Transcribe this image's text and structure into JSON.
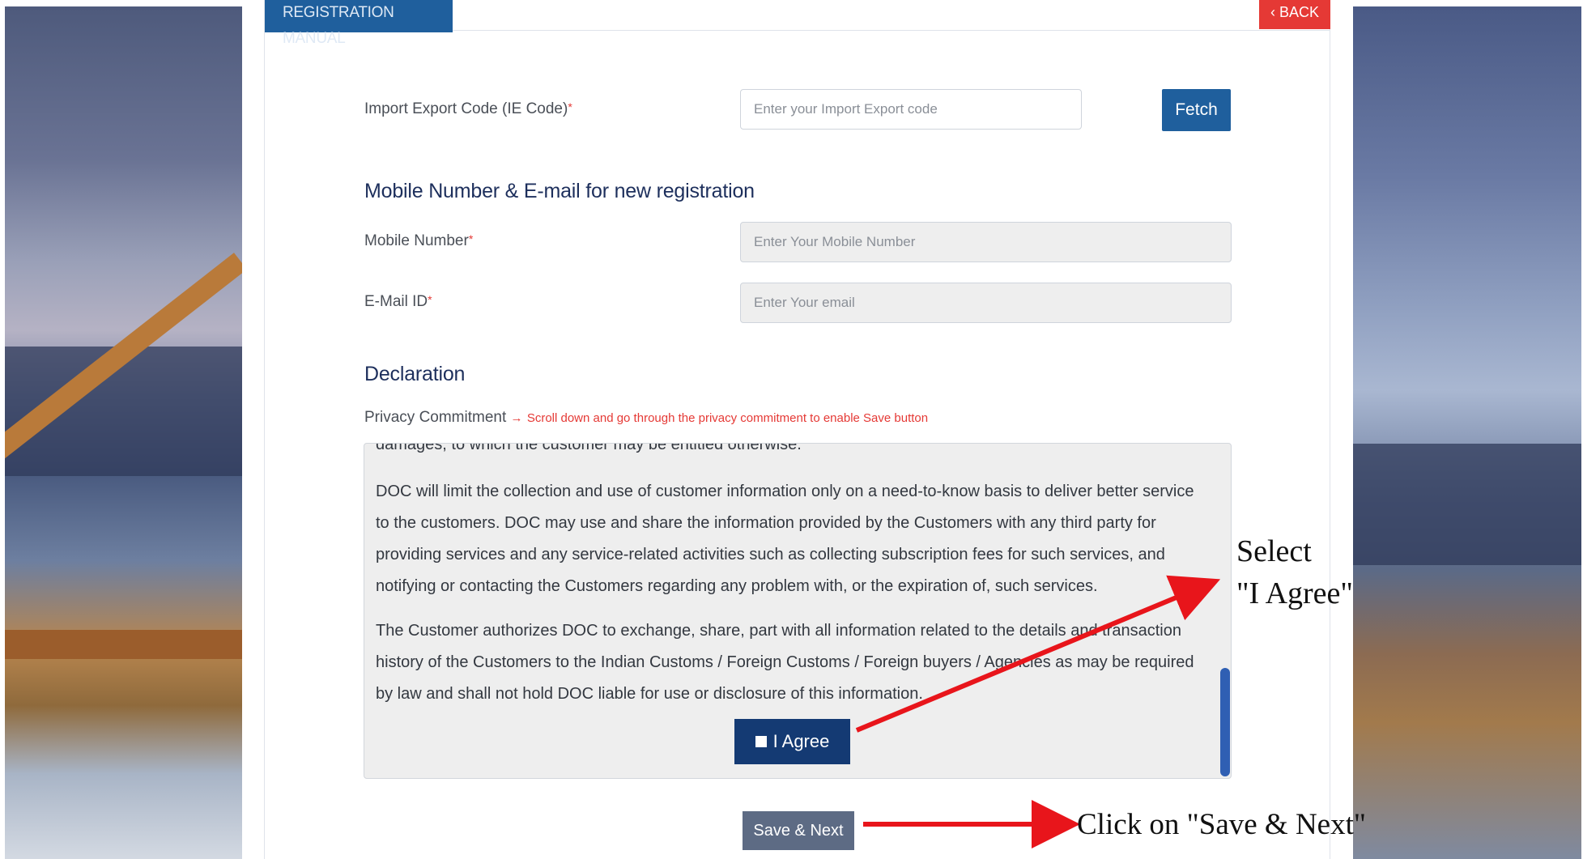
{
  "header": {
    "manual_tab": "REGISTRATION MANUAL",
    "back_button": "‹ BACK"
  },
  "ie_code": {
    "label": "Import Export Code (IE Code)",
    "required_mark": "*",
    "placeholder": "Enter your Import Export code",
    "fetch_button": "Fetch"
  },
  "registration": {
    "section_title": "Mobile Number & E-mail for new registration",
    "mobile_label": "Mobile Number",
    "mobile_placeholder": "Enter Your Mobile Number",
    "email_label": "E-Mail ID",
    "email_placeholder": "Enter Your email",
    "required_mark": "*"
  },
  "declaration": {
    "section_title": "Declaration",
    "privacy_label": "Privacy Commitment",
    "privacy_arrow": "→",
    "privacy_note": "Scroll down and go through the privacy commitment to enable Save button",
    "cut_line": "damages, to which the customer may be entitled otherwise.",
    "paragraph_1": "DOC will limit the collection and use of customer information only on a need-to-know basis to deliver better service to the customers. DOC may use and share the information provided by the Customers with any third party for providing services and any service-related activities such as collecting subscription fees for such services, and notifying or contacting the Customers regarding any problem with, or the expiration of, such services.",
    "paragraph_2": "The Customer authorizes DOC to exchange, share, part with all information related to the details and transaction history of the Customers to the Indian Customs / Foreign Customs / Foreign buyers / Agencies as may be required by law and shall not hold DOC liable for use or disclosure of this information.",
    "agree_button": "I Agree"
  },
  "actions": {
    "save_next": "Save & Next"
  },
  "annotations": {
    "select_line1": "Select",
    "select_line2": "\"I Agree\"",
    "click_save": "Click on \"Save & Next\""
  },
  "colors": {
    "primary": "#1f5f9d",
    "danger": "#e53935",
    "agree_bg": "#143a73",
    "save_bg": "#5d6b84",
    "arrow": "#e8151b"
  }
}
